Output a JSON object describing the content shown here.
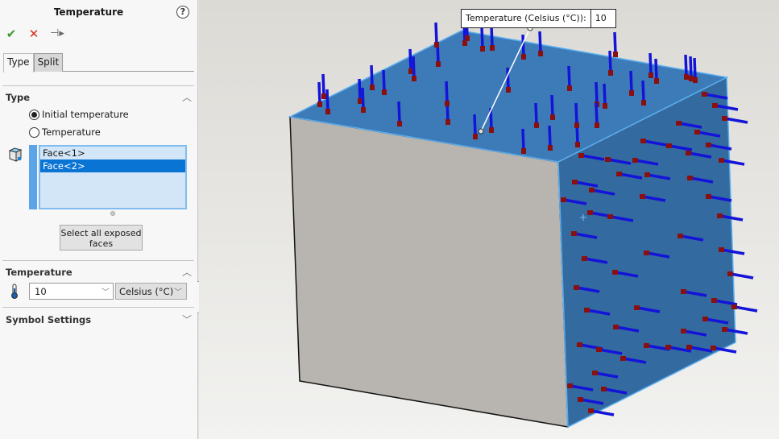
{
  "panel": {
    "title": "Temperature",
    "help_icon": "?",
    "actions": {
      "ok_icon": "✔",
      "cancel_icon": "✕",
      "pin_icon": "⊣⊢"
    },
    "tabs": [
      {
        "label": "Type",
        "active": true
      },
      {
        "label": "Split",
        "active": false
      }
    ],
    "type_section": {
      "title": "Type",
      "options": [
        {
          "label": "Initial temperature",
          "selected": true
        },
        {
          "label": "Temperature",
          "selected": false
        }
      ],
      "faces": [
        {
          "label": "Face<1>",
          "selected": false
        },
        {
          "label": "Face<2>",
          "selected": true
        }
      ],
      "select_all_button": "Select all exposed faces"
    },
    "temperature_section": {
      "title": "Temperature",
      "value": "10",
      "unit": "Celsius (°C)"
    },
    "symbol_settings": {
      "title": "Symbol Settings"
    }
  },
  "viewport": {
    "callout_label": "Temperature (Celsius (°C)):",
    "callout_value": "10",
    "colors": {
      "selected_face": "#3d7ab8",
      "side_face": "#336ba0",
      "front_face": "#b8b5b0",
      "edge_highlight": "#5aaef0",
      "arrow_shaft": "#1414d8",
      "arrow_head": "#8a1010",
      "background": "#e4e3df"
    }
  }
}
